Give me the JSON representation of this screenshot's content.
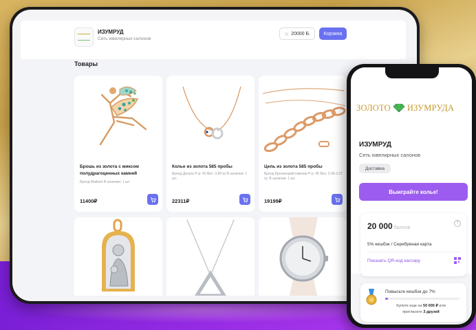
{
  "tablet": {
    "header": {
      "store_name": "ИЗУМРУД",
      "store_subtitle": "Сеть ювелирных салонов",
      "points_balance": "20000 Б.",
      "cart_label": "Корзина"
    },
    "section_title": "Товары",
    "products": [
      {
        "title": "Брошь из золота с миксом полудрагоценных камней",
        "meta": "Бренд Maikom В наличии: 1 шт.",
        "price": "11400₽",
        "image_icon": "brooch-icon"
      },
      {
        "title": "Колье из золота 585 пробы",
        "meta": "Бренд Дельта Р-р: 42 Вес: 3.84 гр В наличии: 1 шт.",
        "price": "22311₽",
        "image_icon": "necklace-icon"
      },
      {
        "title": "Цепь из золота 585 пробы",
        "meta": "Бренд Бронницкий ювелир Р-р: 45 Вес: 3.36-3.37 гр. В наличии: 1 шт.",
        "price": "19199₽",
        "image_icon": "chain-icon"
      },
      {
        "image_icon": "icon-pendant-icon"
      },
      {
        "image_icon": "triangle-pendant-icon"
      },
      {
        "image_icon": "watch-icon"
      }
    ]
  },
  "phone": {
    "brand_part1": "ЗОЛОТО",
    "brand_part2": "ИЗУМРУДА",
    "store_name": "ИЗУМРУД",
    "store_subtitle": "Сеть ювелирных салонов",
    "delivery_label": "Доставка",
    "win_button": "Выиграйте колье!",
    "bonus": {
      "points": "20 000",
      "points_unit": "баллов",
      "help": "?",
      "card_info": "5% кешбэк / Серебряная карта",
      "qr_label": "Показать QR-код кассиру"
    },
    "cashback": {
      "title": "Повысьте кешбэк до 7%",
      "progress": 0.04,
      "line1_prefix": "Купите еще на",
      "line1_amount": "50 000 ₽",
      "line1_suffix": "или",
      "line2_prefix": "пригласите",
      "line2_amount": "3 друзей"
    }
  },
  "colors": {
    "accent_blue": "#6a71f0",
    "accent_purple": "#9d5cf0",
    "gold": "#c79a2b",
    "emerald": "#4fbf5a"
  }
}
